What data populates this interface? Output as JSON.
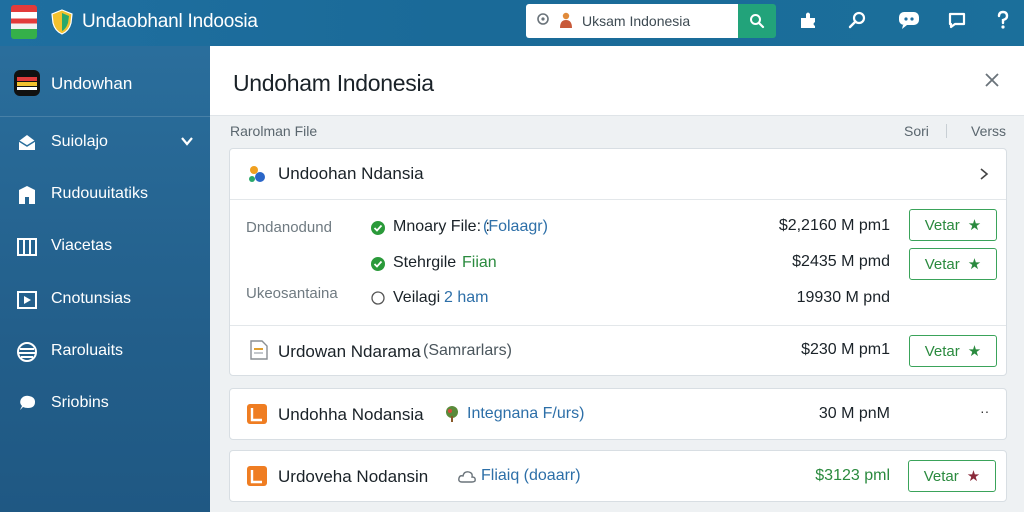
{
  "app": {
    "title": "Undaobhanl Indoosia"
  },
  "search": {
    "value": "Uksam Indonesia",
    "icon": "search-icon"
  },
  "topbar_icons": [
    "puzzle-icon",
    "key-icon",
    "chat-icon",
    "message-icon",
    "help-icon"
  ],
  "sidebar": {
    "header_label": "Undowhan",
    "items": [
      {
        "label": "Suiolajo",
        "icon": "inbox-icon"
      },
      {
        "label": "Rudouuitatiks",
        "icon": "building-icon"
      },
      {
        "label": "Viacetas",
        "icon": "columns-icon"
      },
      {
        "label": "Cnotunsias",
        "icon": "play-icon"
      },
      {
        "label": "Raroluaits",
        "icon": "layers-icon"
      },
      {
        "label": "Sriobins",
        "icon": "chat-icon"
      }
    ]
  },
  "main": {
    "title": "Undoham Indonesia",
    "columns": {
      "file": "Rarolman File",
      "sort": "Sori",
      "verss": "Verss"
    },
    "cards": [
      {
        "name": "Undoohan Ndansia",
        "options": [
          {
            "left": "Dndanodund",
            "label": "Mnoary File: :",
            "link": "(Folaagr)",
            "state": "checked",
            "price": "$2,2160 M pm1",
            "button": "Vetar"
          },
          {
            "left": "",
            "label": "Stehrgile",
            "link": "Fiian",
            "state": "checked",
            "price": "$2435 M pmd",
            "button": "Vetar"
          },
          {
            "left": "Ukeosantaina",
            "label": "Veilagi",
            "link": "2 ham",
            "state": "unchecked",
            "price": "19930 M pnd",
            "button": ""
          }
        ]
      },
      {
        "name": "Urdowan Ndarama",
        "sub": "(Samrarlars)",
        "price": "$230 M pm1",
        "button": "Vetar"
      },
      {
        "name": "Undohha Nodansia",
        "sub": "Integnana F/urs)",
        "price": "30 M pnM",
        "more": "··"
      },
      {
        "name": "Urdoveha Nodansin",
        "sub": "Fliaiq (doaarr)",
        "price": "$3123 pml",
        "button": "Vetar"
      }
    ]
  },
  "colors": {
    "accent": "#22a37a",
    "topbar": "#1f6fa0",
    "sidebar": "#2a6e9c",
    "check": "#2a9a3a"
  }
}
